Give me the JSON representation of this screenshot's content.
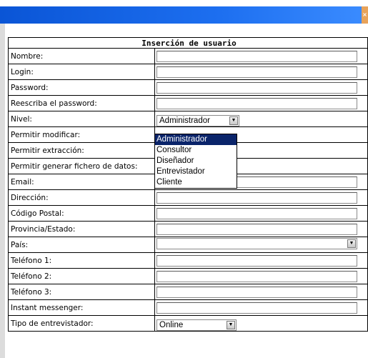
{
  "window": {
    "close_glyph": "×"
  },
  "form": {
    "title": "Inserción de usuario",
    "rows": [
      {
        "label": "Nombre:",
        "type": "input"
      },
      {
        "label": "Login:",
        "type": "input"
      },
      {
        "label": "Password:",
        "type": "input"
      },
      {
        "label": "Reescriba el password:",
        "type": "input"
      },
      {
        "label": "Nivel:",
        "type": "select",
        "value": "Administrador"
      },
      {
        "label": "Permitir modificar:",
        "type": "none"
      },
      {
        "label": "Permitir extracción:",
        "type": "none"
      },
      {
        "label": "Permitir generar fichero de datos:",
        "type": "none"
      },
      {
        "label": "Email:",
        "type": "input"
      },
      {
        "label": "Dirección:",
        "type": "input"
      },
      {
        "label": "Código Postal:",
        "type": "input"
      },
      {
        "label": "Provincia/Estado:",
        "type": "input"
      },
      {
        "label": "País:",
        "type": "select",
        "value": ""
      },
      {
        "label": "Teléfono 1:",
        "type": "input"
      },
      {
        "label": "Teléfono 2:",
        "type": "input"
      },
      {
        "label": "Teléfono 3:",
        "type": "input"
      },
      {
        "label": "Instant messenger:",
        "type": "input"
      },
      {
        "label": "Tipo de entrevistador:",
        "type": "select",
        "value": "Online"
      }
    ]
  },
  "nivel_dropdown": {
    "options": [
      "Administrador",
      "Consultor",
      "Diseñador",
      "Entrevistador",
      "Cliente"
    ],
    "highlighted": "Administrador"
  },
  "colors": {
    "titlebar": "#1d6ff0",
    "highlight": "#0a246a"
  }
}
